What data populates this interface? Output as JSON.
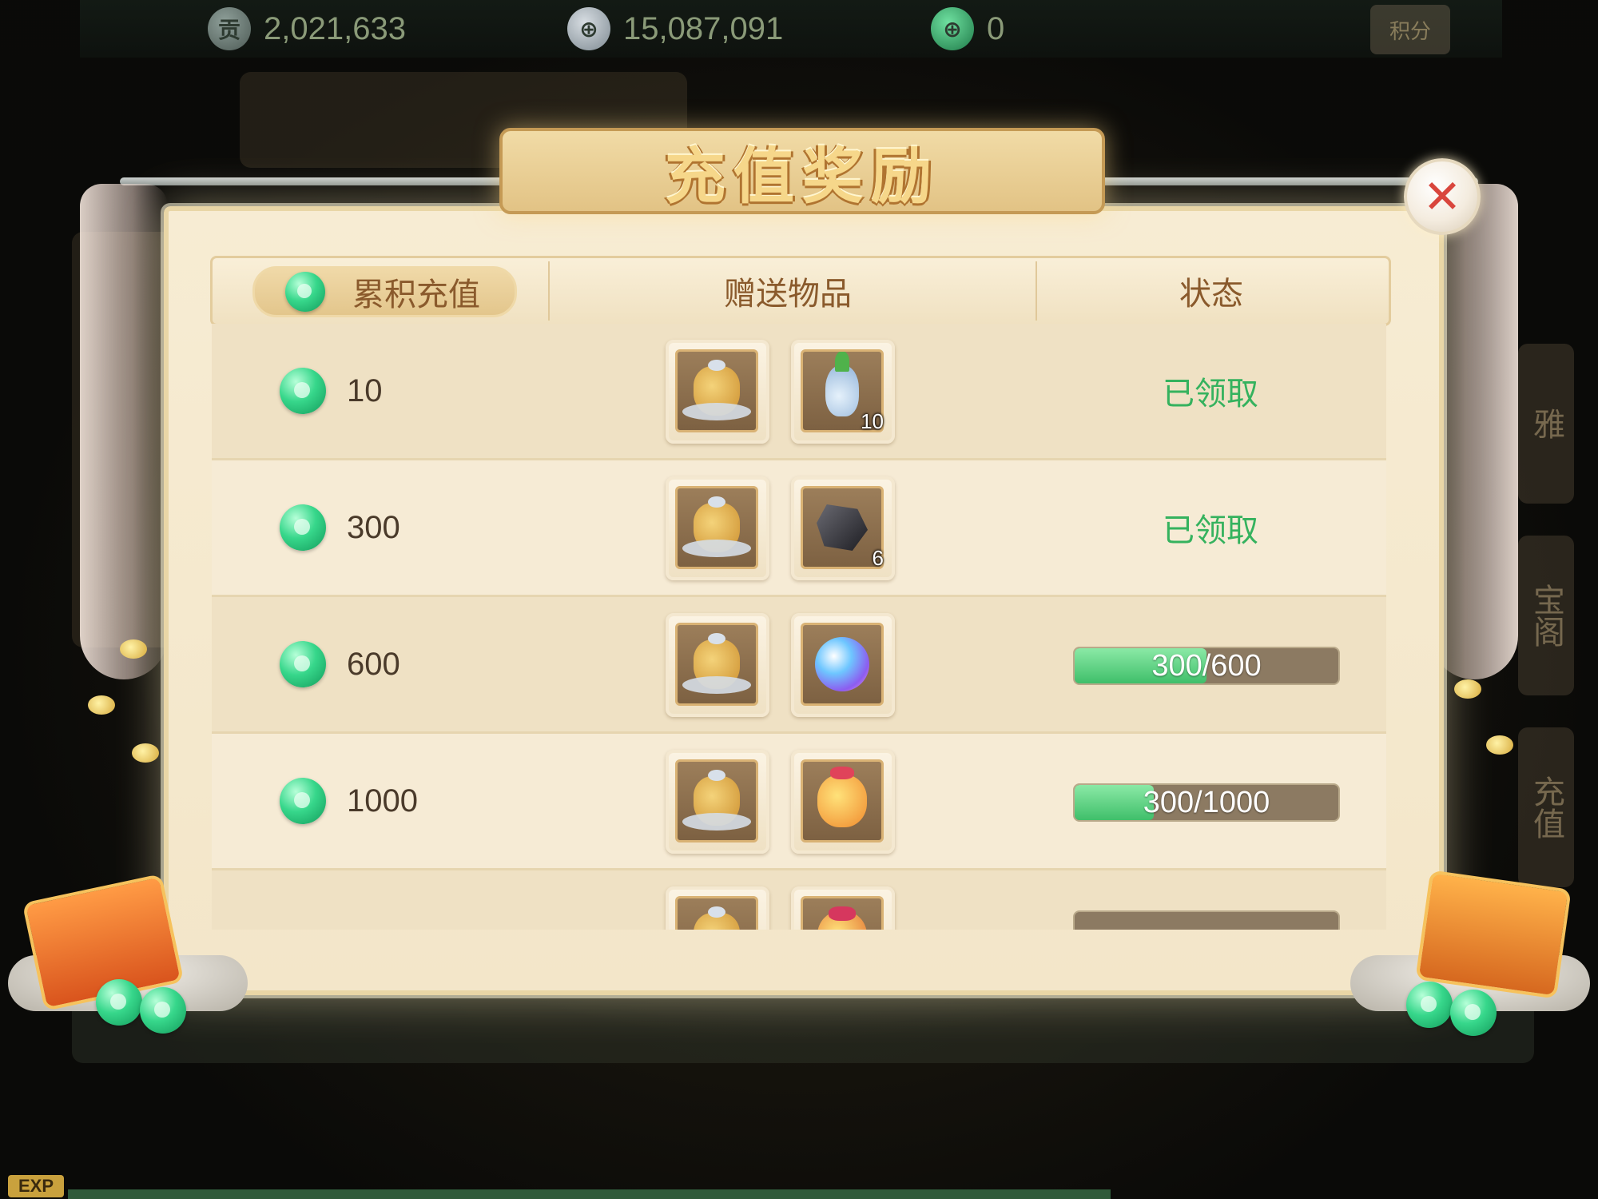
{
  "hud": {
    "contribution": {
      "icon": "contribution-coin-icon",
      "value": "2,021,633"
    },
    "silver": {
      "icon": "silver-ingot-icon",
      "value": "15,087,091"
    },
    "jade": {
      "icon": "jade-icon",
      "value": "0"
    },
    "score_button": {
      "label": "积分"
    }
  },
  "side_tabs": [
    "雅",
    "宝阁",
    "充值"
  ],
  "modal": {
    "title": "充值奖励",
    "close_icon": "close-icon",
    "header": {
      "cumulative_label": "累积充值",
      "gifts_label": "赠送物品",
      "status_label": "状态"
    },
    "rows": [
      {
        "amount": "10",
        "items": [
          {
            "icon": "silver-treasure-bag-icon",
            "count": ""
          },
          {
            "icon": "herb-vase-icon",
            "count": "10"
          }
        ],
        "status": "已领取"
      },
      {
        "amount": "300",
        "items": [
          {
            "icon": "silver-treasure-bag-icon",
            "count": ""
          },
          {
            "icon": "dark-ore-icon",
            "count": "6"
          }
        ],
        "status": "已领取"
      },
      {
        "amount": "600",
        "items": [
          {
            "icon": "silver-treasure-bag-icon",
            "count": ""
          },
          {
            "icon": "crystal-orb-icon",
            "count": ""
          }
        ],
        "progress": {
          "text": "300/600",
          "fraction": 0.5
        }
      },
      {
        "amount": "1000",
        "items": [
          {
            "icon": "silver-treasure-bag-icon",
            "count": ""
          },
          {
            "icon": "lucky-bag-icon",
            "count": ""
          }
        ],
        "progress": {
          "text": "300/1000",
          "fraction": 0.3
        }
      },
      {
        "amount": "",
        "items": [
          {
            "icon": "silver-treasure-bag-icon",
            "count": ""
          },
          {
            "icon": "red-lucky-bag-icon",
            "count": ""
          }
        ],
        "partially_visible": true
      }
    ]
  },
  "footer": {
    "exp_label": "EXP"
  },
  "colors": {
    "claimed_text": "#35b25e",
    "progress_fill": "#3fbf6a",
    "close_x": "#d9463d",
    "title_gold": "#f6d78a"
  }
}
